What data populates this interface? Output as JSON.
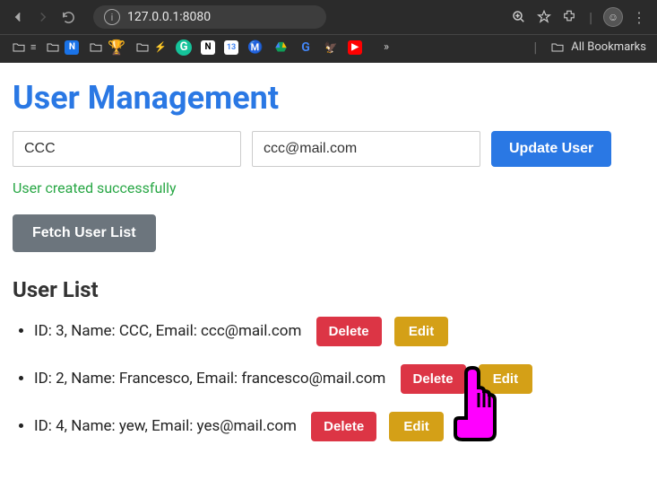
{
  "browser": {
    "url": "127.0.0.1:8080",
    "all_bookmarks": "All Bookmarks"
  },
  "page": {
    "title": "User Management",
    "name_value": "CCC",
    "email_value": "ccc@mail.com",
    "update_btn": "Update User",
    "status": "User created successfully",
    "fetch_btn": "Fetch User List",
    "list_title": "User List",
    "delete_label": "Delete",
    "edit_label": "Edit",
    "users": [
      {
        "id": 3,
        "name": "CCC",
        "email": "ccc@mail.com",
        "display": "ID: 3, Name: CCC, Email: ccc@mail.com"
      },
      {
        "id": 2,
        "name": "Francesco",
        "email": "francesco@mail.com",
        "display": "ID: 2, Name: Francesco, Email: francesco@mail.com"
      },
      {
        "id": 4,
        "name": "yew",
        "email": "yes@mail.com",
        "display": "ID: 4, Name: yew, Email: yes@mail.com"
      }
    ]
  }
}
